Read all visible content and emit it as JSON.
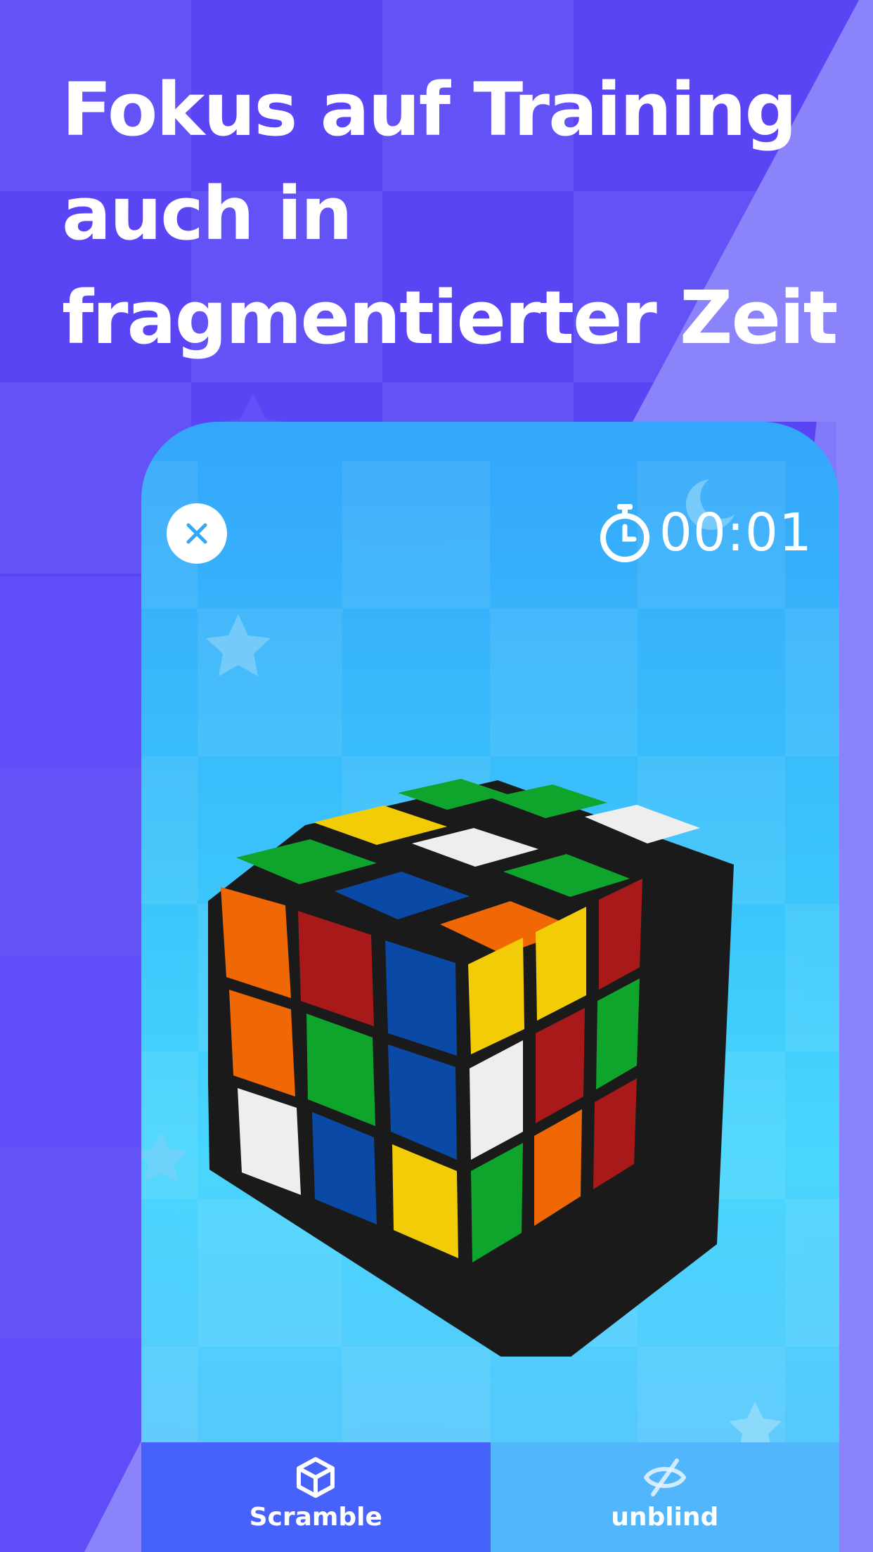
{
  "headline": {
    "lines": [
      "Fokus auf Training",
      "auch in",
      "fragmentierter Zeit"
    ]
  },
  "game": {
    "timer": "00:01",
    "close_icon": "close-icon",
    "timer_icon": "stopwatch-icon"
  },
  "bottom_bar": {
    "scramble_label": "Scramble",
    "scramble_icon": "cube-icon",
    "unblind_label": "unblind",
    "unblind_icon": "eye-slash-icon"
  },
  "colors": {
    "background": "#5a45f5",
    "accent": "#4762fb",
    "phone_sky": "#3cc8fb",
    "cube_green": "#0fa52c",
    "cube_yellow": "#f2cc06",
    "cube_white": "#eeeeee",
    "cube_blue": "#0b49a6",
    "cube_orange": "#f06805",
    "cube_red": "#a81a1a"
  }
}
